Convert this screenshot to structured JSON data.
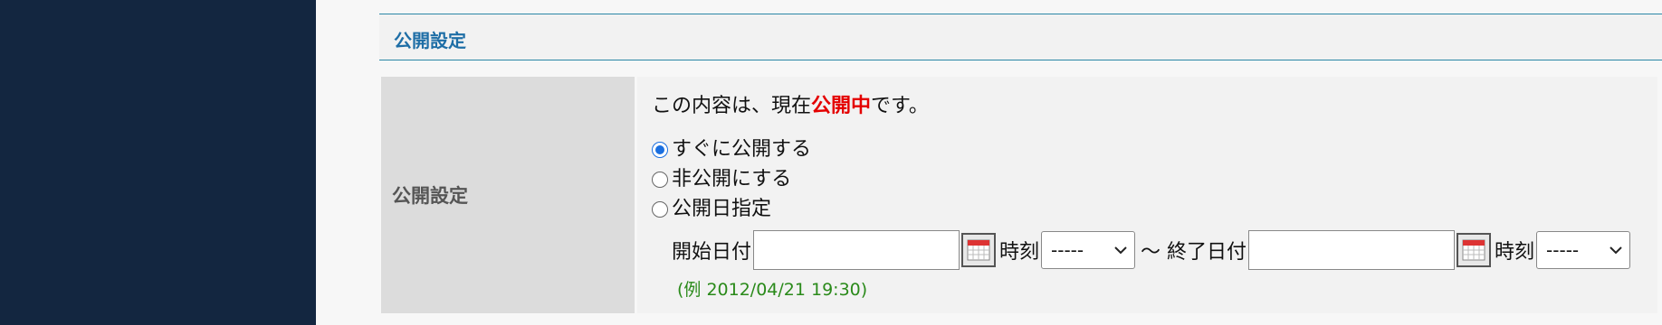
{
  "section": {
    "title": "公開設定"
  },
  "row": {
    "label": "公開設定"
  },
  "status": {
    "prefix": "この内容は、現在",
    "highlight": "公開中",
    "suffix": "です。"
  },
  "options": [
    {
      "label": "すぐに公開する",
      "checked": true
    },
    {
      "label": "非公開にする",
      "checked": false
    },
    {
      "label": "公開日指定",
      "checked": false
    }
  ],
  "date_range": {
    "start_label": "開始日付",
    "start_value": "",
    "time_label_1": "時刻",
    "time_value_1": "-----",
    "separator": "〜 終了日付",
    "end_value": "",
    "time_label_2": "時刻",
    "time_value_2": "-----"
  },
  "example": "(例 2012/04/21 19:30)",
  "colors": {
    "sidebar": "#132640",
    "accent": "#1e6ea6",
    "status_highlight": "#e40000",
    "example": "#2a8a1a"
  }
}
